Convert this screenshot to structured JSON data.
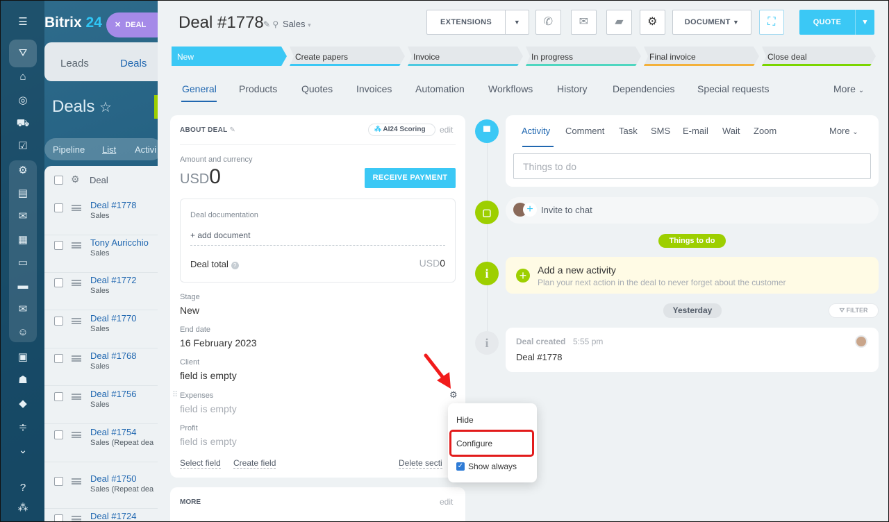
{
  "bg": {
    "logo_main": "Bitrix",
    "logo_num": "24",
    "close_label": "DEAL",
    "tab_leads": "Leads",
    "tab_deals": "Deals",
    "page_title": "Deals",
    "filter_pipeline": "Pipeline",
    "filter_list": "List",
    "filter_activities": "Activi",
    "list_header": "Deal",
    "rows": [
      {
        "name": "Deal #1778",
        "sub": "Sales"
      },
      {
        "name": "Tony Auricchio",
        "sub": "Sales"
      },
      {
        "name": "Deal #1772",
        "sub": "Sales"
      },
      {
        "name": "Deal #1770",
        "sub": "Sales"
      },
      {
        "name": "Deal #1768",
        "sub": "Sales"
      },
      {
        "name": "Deal #1756",
        "sub": "Sales"
      },
      {
        "name": "Deal #1754",
        "sub": "Sales (Repeat dea"
      },
      {
        "name": "Deal #1750",
        "sub": "Sales (Repeat dea"
      },
      {
        "name": "Deal #1724",
        "sub": ""
      }
    ]
  },
  "header": {
    "title": "Deal #1778",
    "category": "Sales",
    "extensions": "EXTENSIONS",
    "document": "DOCUMENT",
    "quote": "QUOTE"
  },
  "stages": [
    {
      "label": "New",
      "color": "#3bc8f5"
    },
    {
      "label": "Create papers",
      "color": "#3bc8f5"
    },
    {
      "label": "Invoice",
      "color": "#4dc9e0"
    },
    {
      "label": "In progress",
      "color": "#4fd6c0"
    },
    {
      "label": "Final invoice",
      "color": "#f3b13b"
    },
    {
      "label": "Close deal",
      "color": "#7bd500"
    }
  ],
  "tabs": {
    "general": "General",
    "products": "Products",
    "quotes": "Quotes",
    "invoices": "Invoices",
    "automation": "Automation",
    "workflows": "Workflows",
    "history": "History",
    "dependencies": "Dependencies",
    "special": "Special requests",
    "more": "More"
  },
  "about": {
    "title": "ABOUT DEAL",
    "scoring": "AI24 Scoring",
    "edit": "edit",
    "amount_label": "Amount and currency",
    "currency": "USD",
    "amount": "0",
    "receive_payment": "RECEIVE PAYMENT",
    "doc_label": "Deal documentation",
    "add_doc": "+ add document",
    "deal_total": "Deal total",
    "total_currency": "USD",
    "total_value": "0",
    "stage_label": "Stage",
    "stage_value": "New",
    "end_label": "End date",
    "end_value": "16 February 2023",
    "client_label": "Client",
    "client_value": "field is empty",
    "expenses_label": "Expenses",
    "expenses_value": "field is empty",
    "profit_label": "Profit",
    "profit_value": "field is empty",
    "select_field": "Select field",
    "create_field": "Create field",
    "delete_section": "Delete secti"
  },
  "more_card": {
    "title": "MORE",
    "edit": "edit"
  },
  "menu": {
    "hide": "Hide",
    "configure": "Configure",
    "show_always": "Show always"
  },
  "activity": {
    "tabs": [
      "Activity",
      "Comment",
      "Task",
      "SMS",
      "E-mail",
      "Wait",
      "Zoom"
    ],
    "more": "More",
    "placeholder": "Things to do",
    "invite": "Invite to chat",
    "things_badge": "Things to do",
    "add_title": "Add a new activity",
    "add_sub": "Plan your next action in the deal to never forget about the customer",
    "yesterday": "Yesterday",
    "filter": "FILTER",
    "created_title": "Deal created",
    "created_time": "5:55 pm",
    "created_body": "Deal #1778"
  }
}
